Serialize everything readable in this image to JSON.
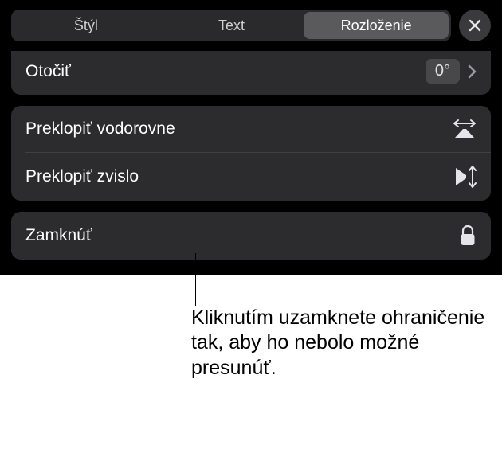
{
  "tabs": {
    "style": "Štýl",
    "text": "Text",
    "layout": "Rozloženie"
  },
  "rotate": {
    "label": "Otočiť",
    "value": "0°"
  },
  "flip_horizontal": {
    "label": "Preklopiť vodorovne"
  },
  "flip_vertical": {
    "label": "Preklopiť zvislo"
  },
  "lock": {
    "label": "Zamknúť"
  },
  "callout": {
    "text": "Kliknutím uzamknete ohraničenie tak, aby ho nebolo možné presunúť."
  }
}
